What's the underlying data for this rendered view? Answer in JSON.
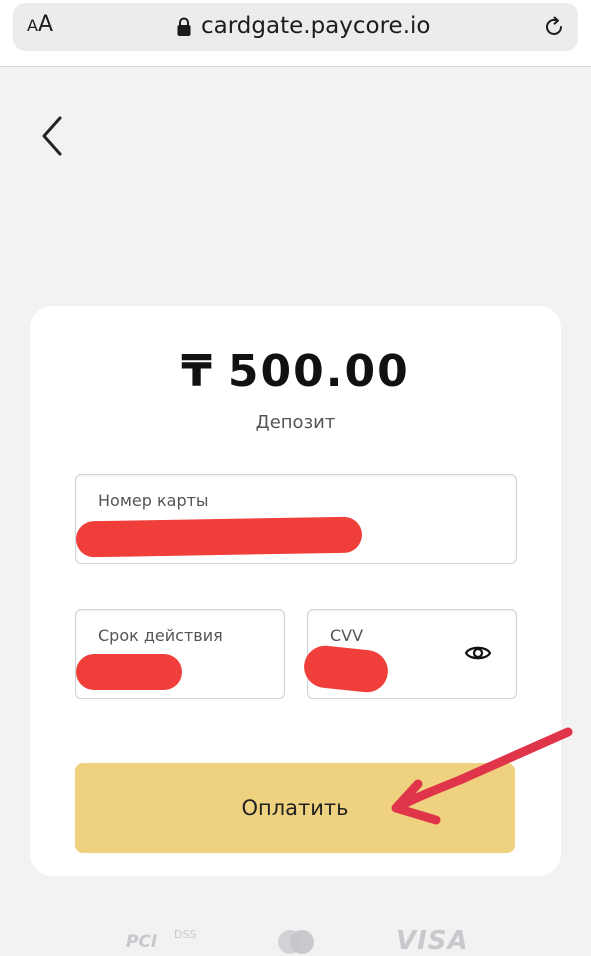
{
  "browser": {
    "aa_small": "A",
    "aa_large": "A",
    "url": "cardgate.paycore.io",
    "lock_icon": "lock-icon",
    "reload_icon": "reload-icon"
  },
  "nav": {
    "back_icon": "chevron-left-icon"
  },
  "payment": {
    "currency_symbol": "₸",
    "amount": "500.00",
    "purpose": "Депозит",
    "card_number": {
      "label": "Номер карты",
      "value": ""
    },
    "expiry": {
      "label": "Срок действия",
      "value": ""
    },
    "cvv": {
      "label": "CVV",
      "value": "",
      "toggle_icon": "eye-icon"
    },
    "pay_button_label": "Оплатить"
  },
  "footer": {
    "logos": {
      "pci": "PCI",
      "dss": "DSS",
      "visa": "VISA",
      "mastercard": "mastercard-logo"
    }
  },
  "annotations": {
    "arrow_color": "#e0344a",
    "redaction_color": "#f03e3a"
  },
  "colors": {
    "pay_button": "#efd27f",
    "background": "#f2f2f3",
    "card": "#ffffff"
  }
}
